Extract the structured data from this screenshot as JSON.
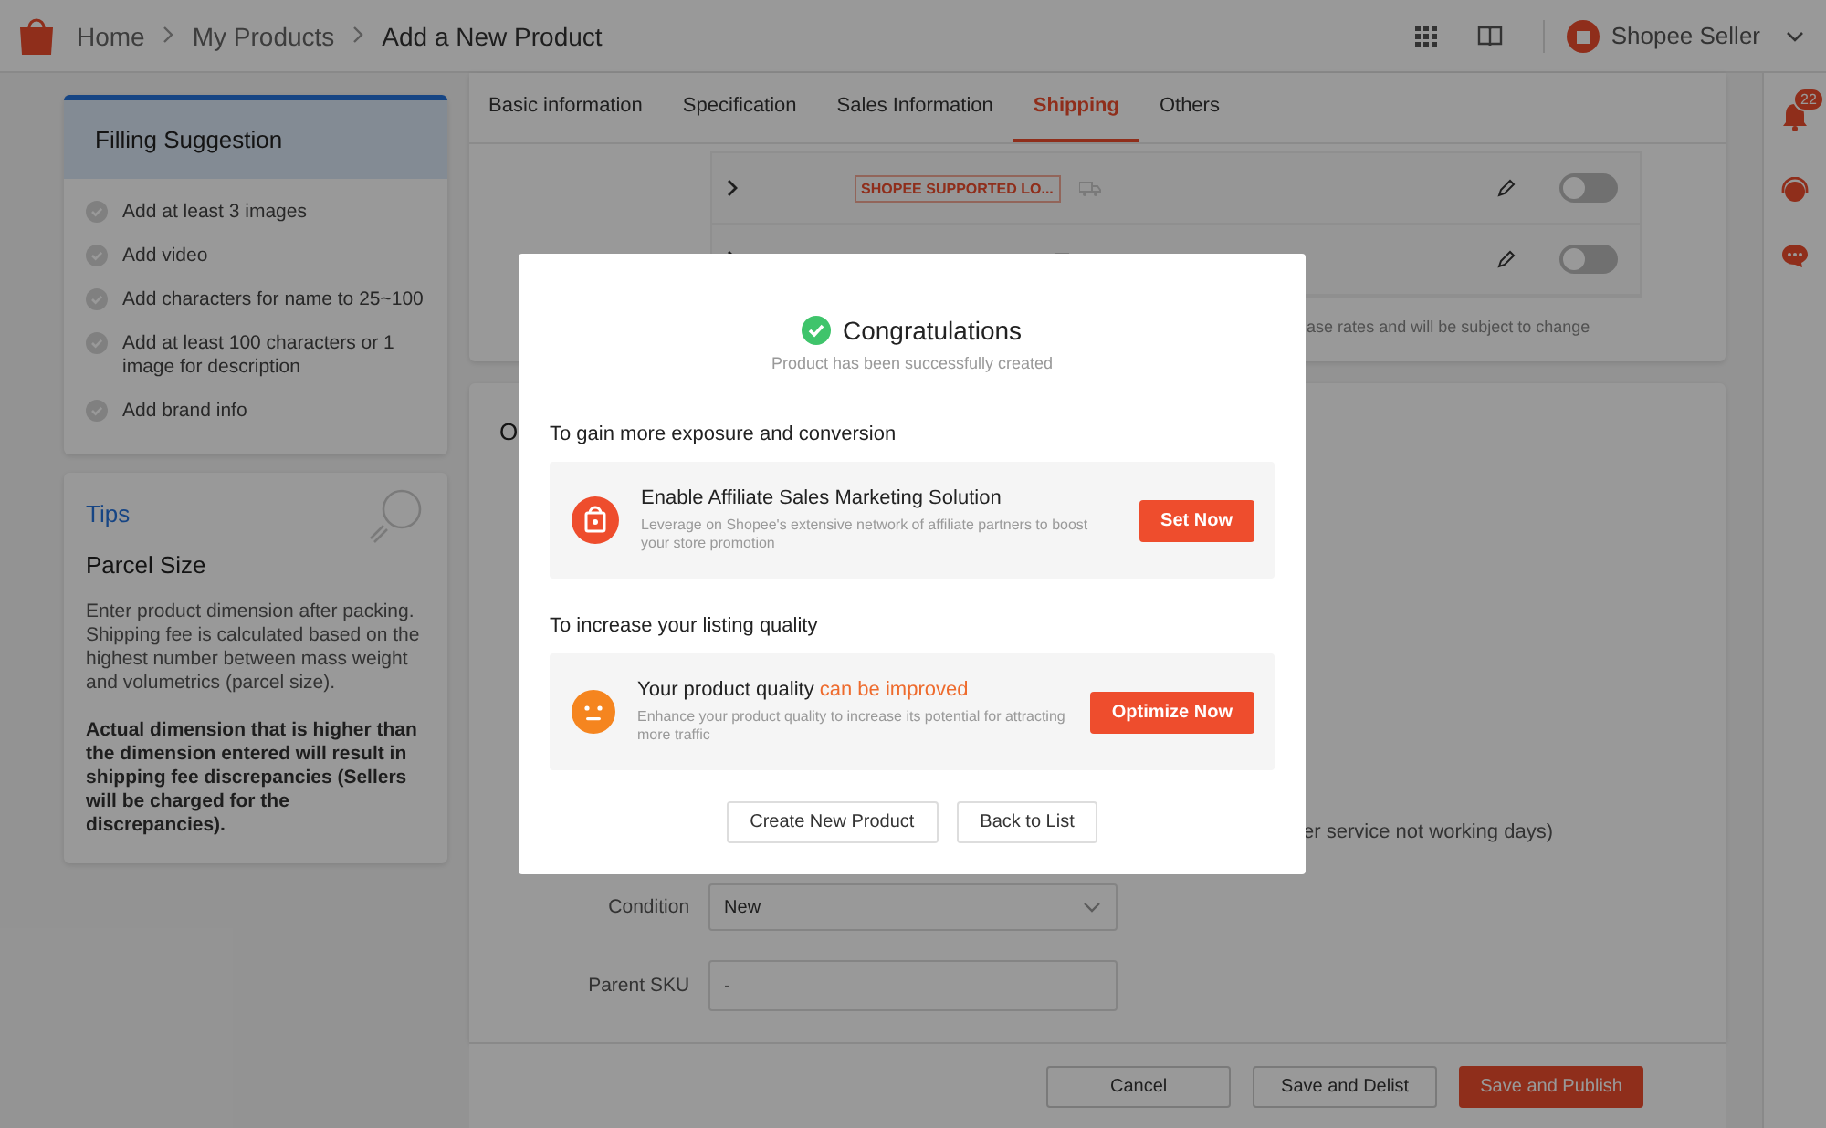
{
  "breadcrumb": [
    "Home",
    "My Products",
    "Add a New Product"
  ],
  "account": {
    "name": "Shopee Seller"
  },
  "filling_suggestion": {
    "title": "Filling Suggestion",
    "items": [
      "Add at least 3 images",
      "Add video",
      "Add characters for name to 25~100",
      "Add at least 100 characters or 1 image for description",
      "Add brand info"
    ]
  },
  "tips": {
    "title": "Tips",
    "heading": "Parcel Size",
    "body": "Enter product dimension after packing. Shipping fee is calculated based on the highest number between mass weight and volumetrics (parcel size).",
    "warning": "Actual dimension that is higher than the dimension entered will result in shipping fee discrepancies (Sellers will be charged for the discrepancies)."
  },
  "tabs": [
    {
      "label": "Basic information",
      "selected": false
    },
    {
      "label": "Specification",
      "selected": false
    },
    {
      "label": "Sales Information",
      "selected": false
    },
    {
      "label": "Shipping",
      "selected": true
    },
    {
      "label": "Others",
      "selected": false
    }
  ],
  "shipping_rows": [
    {
      "tag": "SHOPEE SUPPORTED LO...",
      "on": false
    },
    {
      "on": false
    }
  ],
  "shipping_note": "ase rates and will be subject to change",
  "others": {
    "title": "O",
    "preorder_note": "er service not working days)",
    "condition": {
      "label": "Condition",
      "value": "New"
    },
    "parent_sku": {
      "label": "Parent SKU",
      "placeholder": "-"
    }
  },
  "footer_buttons": [
    "Cancel",
    "Save and Delist",
    "Save and Publish"
  ],
  "notifications": {
    "count": "22"
  },
  "dialog": {
    "title": "Congratulations",
    "subtitle": "Product has been successfully created",
    "sections": [
      {
        "heading": "To gain more exposure and conversion",
        "kind": "affiliate",
        "title": "Enable Affiliate Sales Marketing Solution",
        "description": "Leverage on Shopee's extensive network of affiliate partners to boost your store promotion",
        "action": "Set Now"
      },
      {
        "heading": "To increase your listing quality",
        "kind": "quality",
        "title": "Your product quality ",
        "highlight": "can be improved",
        "description": "Enhance your product quality to increase its potential for attracting more traffic",
        "action": "Optimize Now"
      }
    ],
    "buttons": [
      "Create New Product",
      "Back to List"
    ]
  }
}
